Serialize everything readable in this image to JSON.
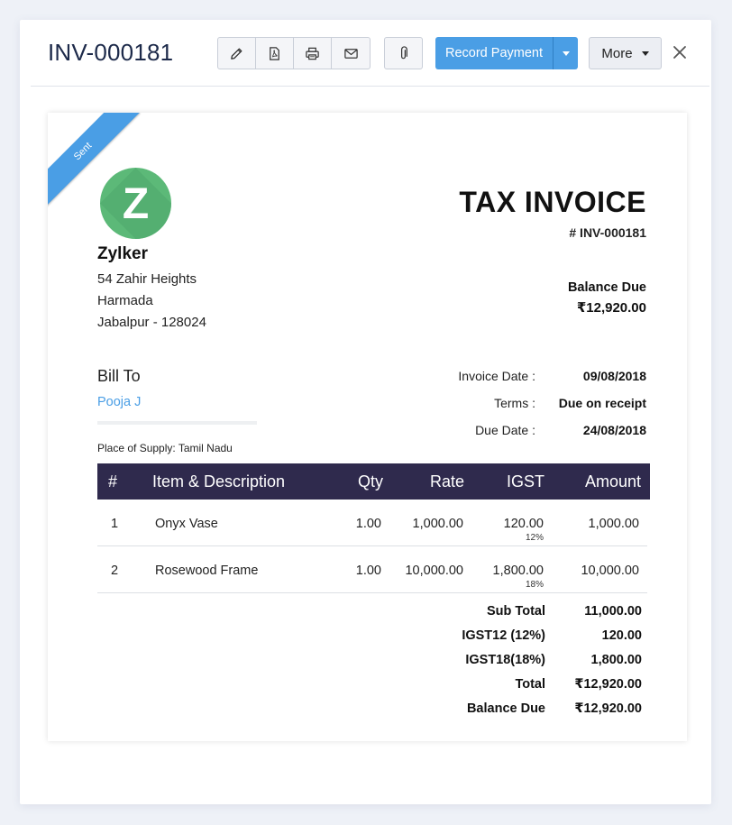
{
  "header": {
    "title": "INV-000181",
    "record_payment_label": "Record Payment",
    "more_label": "More"
  },
  "invoice": {
    "status_ribbon": "Sent",
    "logo_letter": "Z",
    "company_name": "Zylker",
    "address_lines": [
      "54 Zahir Heights",
      "Harmada",
      "Jabalpur - 128024"
    ],
    "doc_title": "TAX INVOICE",
    "number": "# INV-000181",
    "balance_due_label": "Balance Due",
    "balance_due_value": "₹12,920.00",
    "bill_to_label": "Bill To",
    "client_name": "Pooja J",
    "place_of_supply": "Place of Supply: Tamil Nadu",
    "meta": [
      {
        "label": "Invoice Date :",
        "value": "09/08/2018"
      },
      {
        "label": "Terms :",
        "value": "Due on receipt"
      },
      {
        "label": "Due Date :",
        "value": "24/08/2018"
      }
    ],
    "columns": [
      "#",
      "Item & Description",
      "Qty",
      "Rate",
      "IGST",
      "Amount"
    ],
    "items": [
      {
        "num": "1",
        "description": "Onyx Vase",
        "qty": "1.00",
        "rate": "1,000.00",
        "igst": "120.00",
        "igst_pct": "12%",
        "amount": "1,000.00"
      },
      {
        "num": "2",
        "description": "Rosewood Frame",
        "qty": "1.00",
        "rate": "10,000.00",
        "igst": "1,800.00",
        "igst_pct": "18%",
        "amount": "10,000.00"
      }
    ],
    "totals": [
      {
        "label": "Sub Total",
        "value": "11,000.00"
      },
      {
        "label": "IGST12 (12%)",
        "value": "120.00"
      },
      {
        "label": "IGST18(18%)",
        "value": "1,800.00"
      },
      {
        "label": "Total",
        "value": "₹12,920.00"
      },
      {
        "label": "Balance Due",
        "value": "₹12,920.00"
      }
    ]
  },
  "colors": {
    "accent_blue": "#4a9ee5",
    "table_header_bg": "#2f2a4d",
    "logo_green": "#5cb978",
    "title_navy": "#1d2a4a"
  },
  "icons": [
    "edit-icon",
    "pdf-icon",
    "print-icon",
    "email-icon",
    "attachment-icon",
    "chevron-down-icon",
    "close-icon"
  ]
}
